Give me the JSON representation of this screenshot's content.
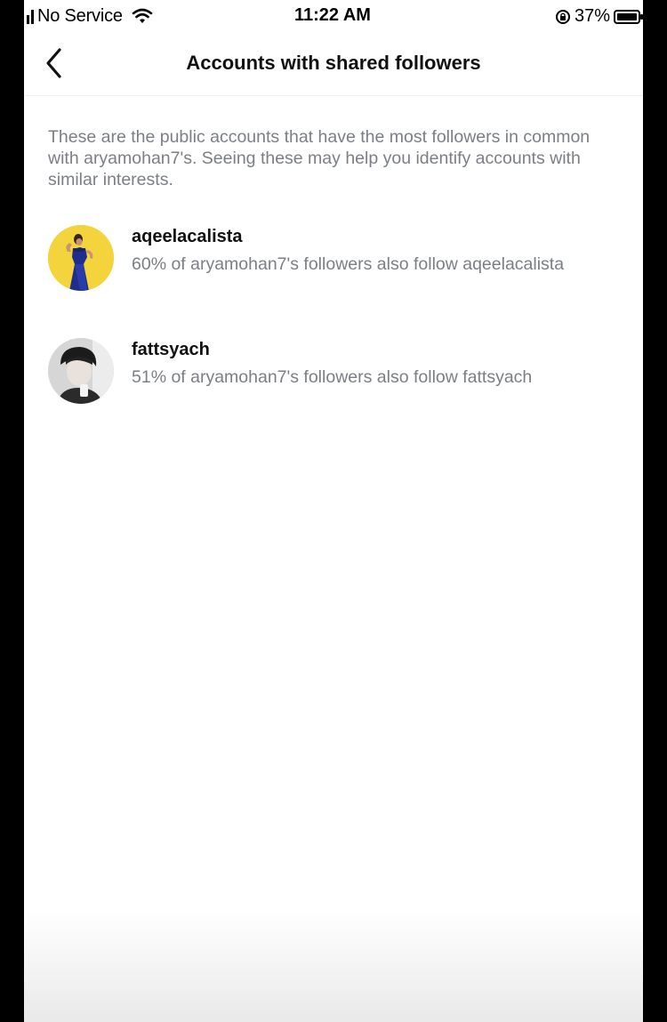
{
  "status_bar": {
    "carrier": "No Service",
    "time": "11:22 AM",
    "battery_percent": "37%",
    "icons": [
      "signal-icon",
      "wifi-icon",
      "rotation-lock-icon",
      "battery-icon"
    ]
  },
  "header": {
    "title": "Accounts with shared followers",
    "back_icon": "chevron-left-icon"
  },
  "description": "These are the public accounts that have the most followers in common with aryamohan7's. Seeing these may help you identify accounts with similar interests.",
  "accounts": [
    {
      "username": "aqeelacalista",
      "detail": "60% of aryamohan7's followers also follow aqeelacalista",
      "avatar_bg": "#f2d13a"
    },
    {
      "username": "fattsyach",
      "detail": "51% of aryamohan7's followers also follow fattsyach",
      "avatar_bg": "#d9d9d9"
    }
  ],
  "colors": {
    "title_text": "#111111",
    "secondary_text": "#7b7f85",
    "background": "#ffffff"
  }
}
